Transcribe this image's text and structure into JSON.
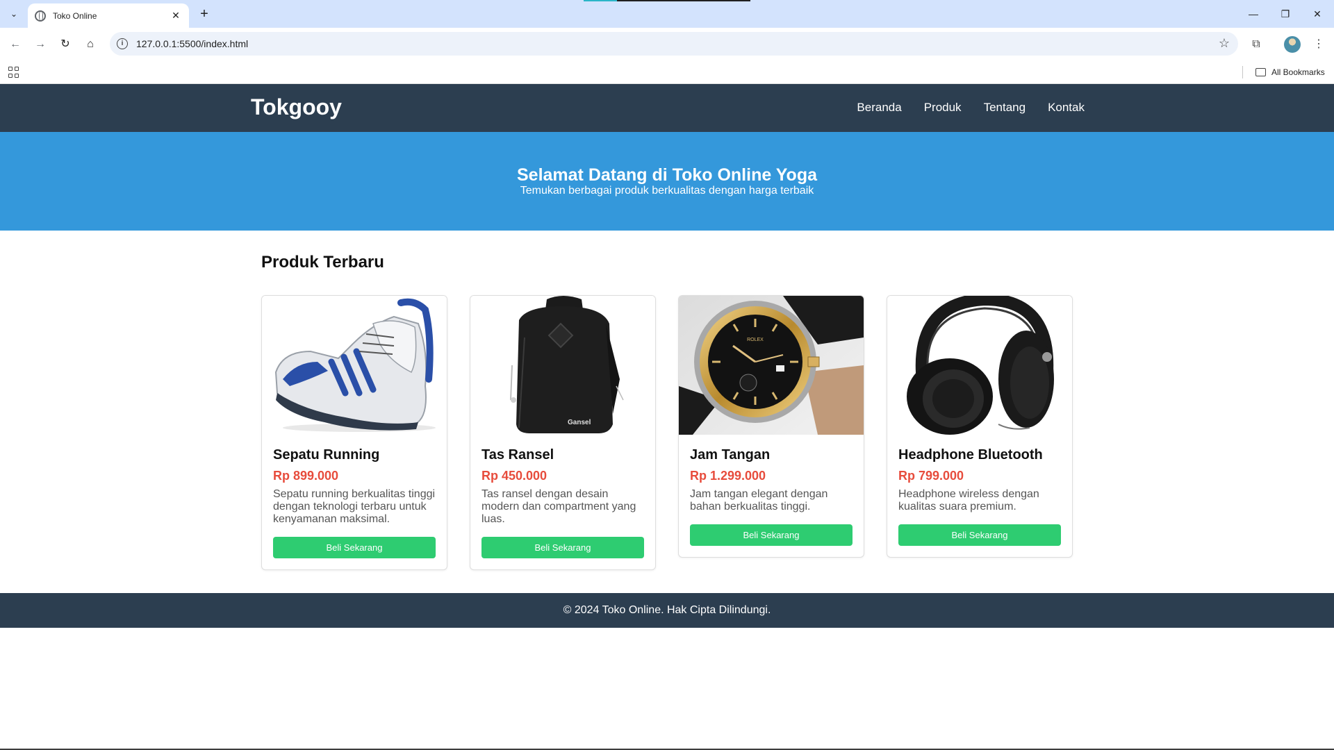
{
  "browser": {
    "tab_title": "Toko Online",
    "url": "127.0.0.1:5500/index.html",
    "bookmarks_label": "All Bookmarks"
  },
  "site": {
    "logo": "Tokgooy",
    "nav": [
      "Beranda",
      "Produk",
      "Tentang",
      "Kontak"
    ],
    "hero_title": "Selamat Datang di Toko Online Yoga",
    "hero_subtitle": "Temukan berbagai produk berkualitas dengan harga terbaik",
    "section_title": "Produk Terbaru",
    "footer": "© 2024 Toko Online. Hak Cipta Dilindungi."
  },
  "products": [
    {
      "name": "Sepatu Running",
      "price": "Rp 899.000",
      "desc": "Sepatu running berkualitas tinggi dengan teknologi terbaru untuk kenyamanan maksimal.",
      "button": "Beli Sekarang",
      "image": "running-shoe"
    },
    {
      "name": "Tas Ransel",
      "price": "Rp 450.000",
      "desc": "Tas ransel dengan desain modern dan compartment yang luas.",
      "button": "Beli Sekarang",
      "image": "backpack",
      "brand_mark": "Gansel"
    },
    {
      "name": "Jam Tangan",
      "price": "Rp 1.299.000",
      "desc": "Jam tangan elegant dengan bahan berkualitas tinggi.",
      "button": "Beli Sekarang",
      "image": "wristwatch",
      "brand_mark": "ROLEX"
    },
    {
      "name": "Headphone Bluetooth",
      "price": "Rp 799.000",
      "desc": "Headphone wireless dengan kualitas suara premium.",
      "button": "Beli Sekarang",
      "image": "headphones"
    }
  ],
  "colors": {
    "header_bg": "#2c3e50",
    "hero_bg": "#3498db",
    "price": "#e74c3c",
    "button": "#2ecc71"
  }
}
